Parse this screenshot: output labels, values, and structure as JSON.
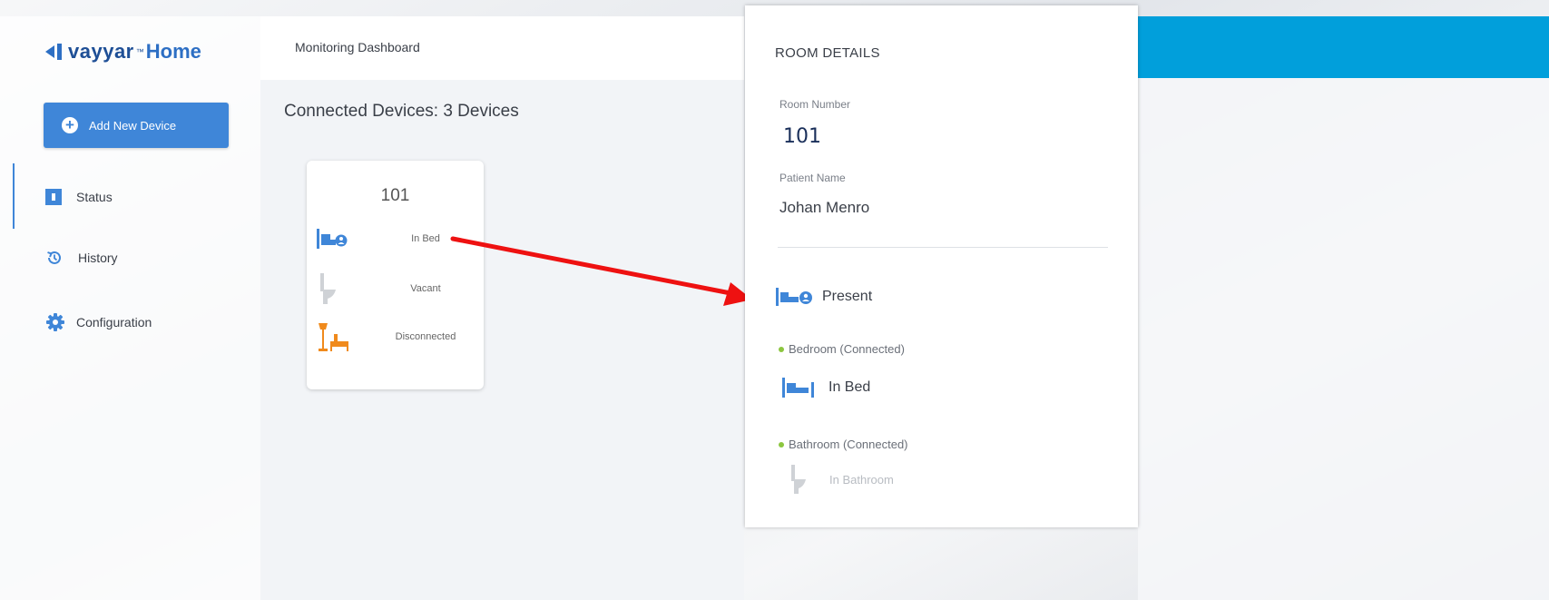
{
  "app": {
    "brand": "vayyar",
    "trademark": "™",
    "product": "Home"
  },
  "sidebar": {
    "add_button_label": "Add New Device",
    "items": [
      {
        "label": "Status",
        "icon": "status-icon"
      },
      {
        "label": "History",
        "icon": "history-icon"
      },
      {
        "label": "Configuration",
        "icon": "gear-icon"
      }
    ]
  },
  "header": {
    "title": "Monitoring Dashboard"
  },
  "main": {
    "connected_devices": "Connected Devices: 3 Devices",
    "device_card": {
      "room": "101",
      "rows": [
        {
          "label": "In Bed",
          "icon": "bed-icon"
        },
        {
          "label": "Vacant",
          "icon": "toilet-icon"
        },
        {
          "label": "Disconnected",
          "icon": "lamp-chair-icon"
        }
      ]
    }
  },
  "room_details": {
    "title": "ROOM DETAILS",
    "room_number_label": "Room Number",
    "room_number": "101",
    "patient_name_label": "Patient Name",
    "patient_name": "Johan Menro",
    "presence": "Present",
    "bedroom_label": "Bedroom (Connected)",
    "bedroom_status": "In Bed",
    "bathroom_label": "Bathroom (Connected)",
    "bathroom_status": "In Bathroom"
  },
  "colors": {
    "accent": "#3f86d8",
    "header_bar": "#019fdb",
    "connected_dot": "#8cc63f",
    "arrow": "#ee1111",
    "disconnected_icon": "#f08a1c"
  }
}
